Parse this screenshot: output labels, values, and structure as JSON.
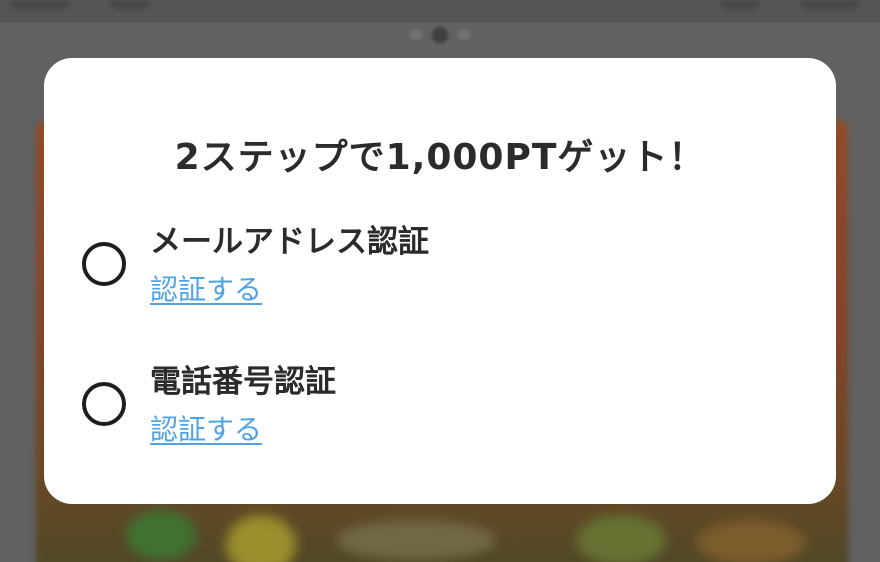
{
  "modal": {
    "title": "2ステップで1,000PTゲット！",
    "steps": [
      {
        "label": "メールアドレス認証",
        "link_label": "認証する",
        "checked": false
      },
      {
        "label": "電話番号認証",
        "link_label": "認証する",
        "checked": false
      }
    ]
  },
  "colors": {
    "overlay": "#707070",
    "modal_background": "#ffffff",
    "title_text": "#2b2b2b",
    "link": "#4fa3e2",
    "radio_border": "#1e1e1e",
    "banner_orange": "#b8501b"
  },
  "carousel": {
    "page_count": 3,
    "active_index": 1
  }
}
